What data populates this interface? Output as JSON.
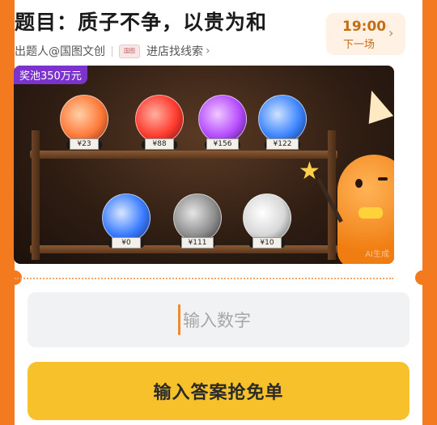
{
  "question": {
    "title": "题目：质子不争，以贵为和",
    "setter": "出题人@国图文创",
    "shop_badge": "国图",
    "shop_link": "进店找线索",
    "chevron": "›"
  },
  "schedule": {
    "time": "19:00",
    "next_label": "下一场",
    "chevron": "›"
  },
  "prize": {
    "pool_label": "奖池350万元"
  },
  "orbs": {
    "top": [
      {
        "price": "¥23",
        "color": "#ff7a3a"
      },
      {
        "price": "¥88",
        "color": "#ff3b2f"
      },
      {
        "price": "¥156",
        "color": "#b64dff"
      },
      {
        "price": "¥122",
        "color": "#3d86ff"
      }
    ],
    "bottom": [
      {
        "price": "¥0",
        "color": "#3b7dff"
      },
      {
        "price": "¥111",
        "color": "#a3a3a3"
      },
      {
        "price": "¥10",
        "color": "#e4e4e4"
      }
    ]
  },
  "watermark": "AI生成",
  "answer": {
    "placeholder": "输入数字",
    "value": ""
  },
  "submit": {
    "label": "输入答案抢免单"
  },
  "colors": {
    "frame": "#f47a1f",
    "accent": "#f7c12b",
    "pool_badge": "#7a33cc"
  }
}
